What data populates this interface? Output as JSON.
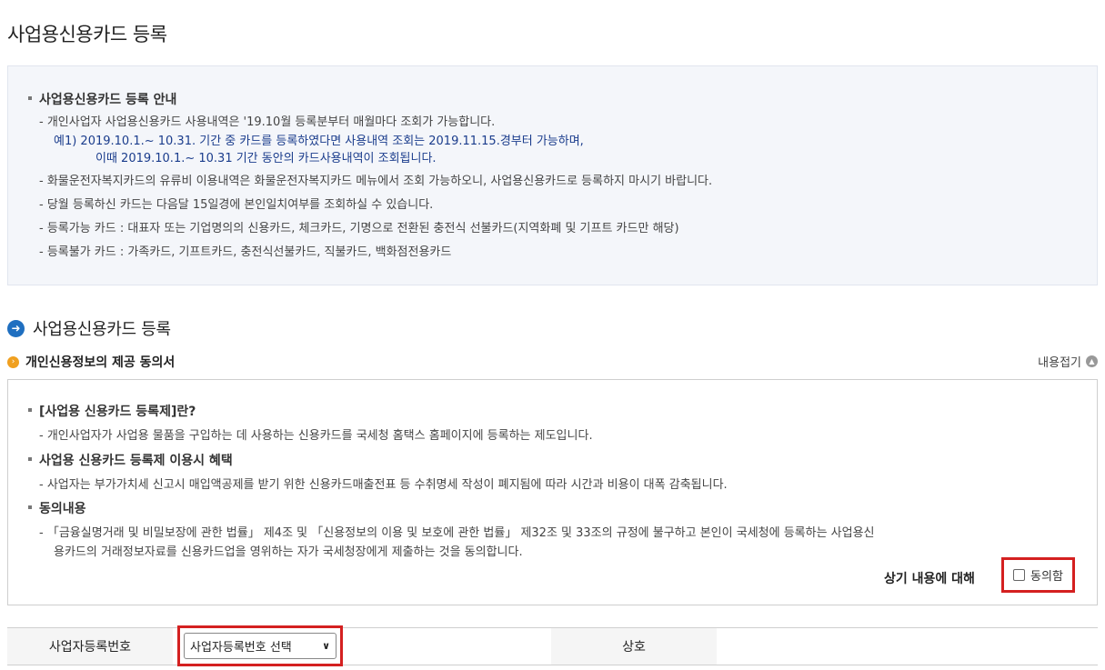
{
  "page": {
    "title": "사업용신용카드 등록"
  },
  "notice": {
    "heading": "사업용신용카드 등록 안내",
    "lines": [
      "- 개인사업자 사업용신용카드 사용내역은 '19.10월 등록분부터 매월마다 조회가 가능합니다.",
      "예1) 2019.10.1.~ 10.31. 기간 중 카드를 등록하였다면 사용내역 조회는 2019.11.15.경부터 가능하며,",
      "이때 2019.10.1.~ 10.31 기간 동안의 카드사용내역이 조회됩니다.",
      "- 화물운전자복지카드의 유류비 이용내역은 화물운전자복지카드 메뉴에서 조회 가능하오니, 사업용신용카드로 등록하지 마시기 바랍니다.",
      "- 당월 등록하신 카드는 다음달 15일경에 본인일치여부를 조회하실 수 있습니다.",
      "- 등록가능 카드 : 대표자 또는 기업명의의 신용카드, 체크카드, 기명으로 전환된 충전식 선불카드(지역화폐 및 기프트 카드만 해당)",
      "- 등록불가 카드 : 가족카드, 기프트카드, 충전식선불카드, 직불카드, 백화점전용카드"
    ]
  },
  "section": {
    "title": "사업용신용카드 등록"
  },
  "consent": {
    "title": "개인신용정보의 제공 동의서",
    "collapse_label": "내용접기",
    "h1": "[사업용 신용카드 등록제]란?",
    "d1": "- 개인사업자가 사업용 물품을 구입하는 데 사용하는 신용카드를 국세청 홈택스 홈페이지에 등록하는 제도입니다.",
    "h2": "사업용 신용카드 등록제 이용시 혜택",
    "d2": "- 사업자는 부가가치세 신고시 매입액공제를 받기 위한 신용카드매출전표 등 수취명세 작성이 폐지됨에 따라 시간과 비용이 대폭 감축됩니다.",
    "h3": "동의내용",
    "d3a": "- 「금융실명거래 및 비밀보장에 관한 법률」 제4조 및 「신용정보의 이용 및 보호에 관한 법률」 제32조 및 33조의 규정에 불구하고 본인이 국세청에 등록하는 사업용신",
    "d3b": "용카드의    거래정보자료를 신용카드업을 영위하는 자가 국세청장에게 제출하는 것을 동의합니다.",
    "agree_prompt": "상기 내용에 대해",
    "agree_label": "동의함"
  },
  "form": {
    "biz_no_label": "사업자등록번호",
    "biz_no_select": "사업자등록번호 선택",
    "trade_name_label": "상호"
  }
}
